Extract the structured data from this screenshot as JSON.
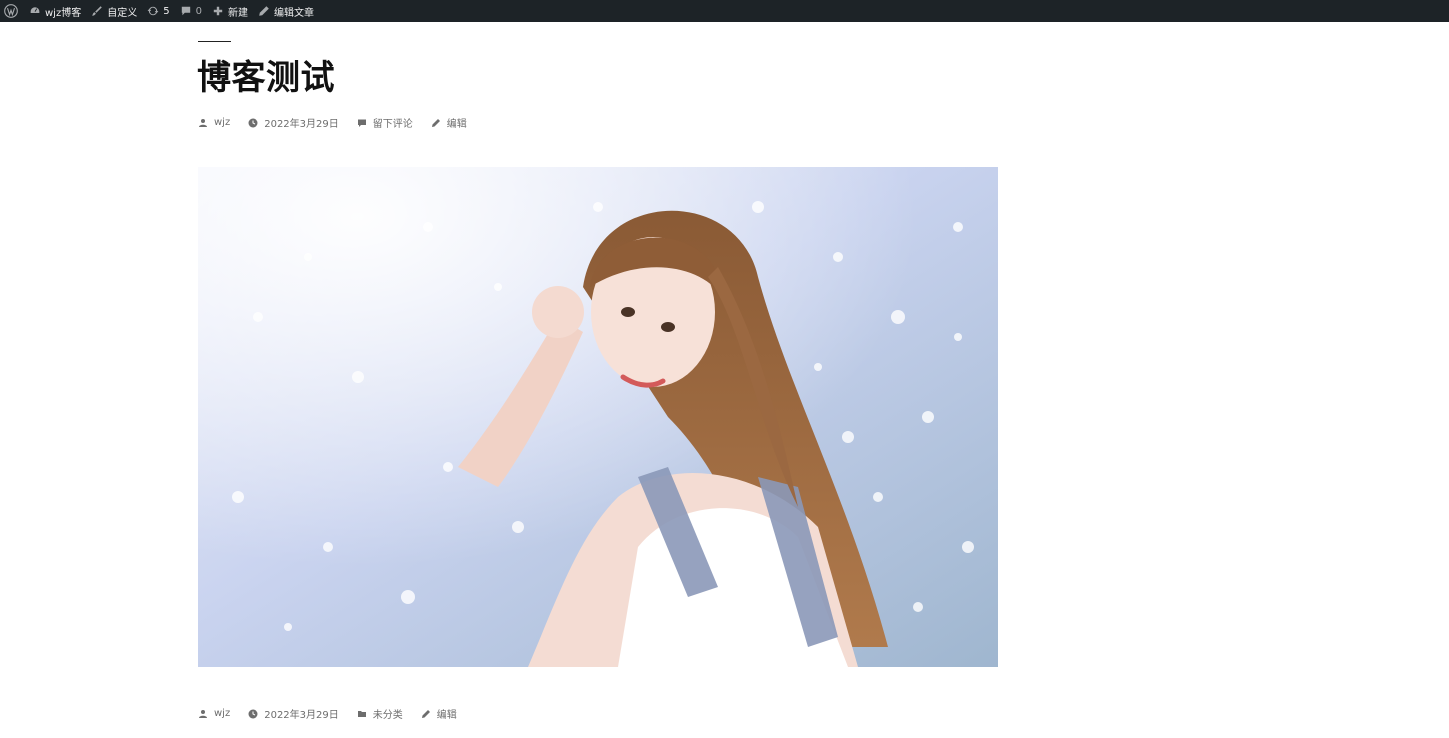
{
  "adminbar": {
    "items": [
      {
        "icon": "wordpress-logo-icon",
        "label": ""
      },
      {
        "icon": "dashboard-icon",
        "label": "wjz博客"
      },
      {
        "icon": "brush-icon",
        "label": "自定义"
      },
      {
        "icon": "updates-icon",
        "label": "5"
      },
      {
        "icon": "comment-icon",
        "label": "0"
      },
      {
        "icon": "plus-icon",
        "label": "新建"
      },
      {
        "icon": "pencil-icon",
        "label": "编辑文章"
      }
    ]
  },
  "post": {
    "title": "博客测试",
    "meta_top": {
      "author": "wjz",
      "date": "2022年3月29日",
      "comments": "留下评论",
      "edit": "编辑"
    },
    "featured_image": {
      "description_icon": "photo-icon"
    },
    "meta_bottom": {
      "author": "wjz",
      "date": "2022年3月29日",
      "category": "未分类",
      "edit": "编辑"
    }
  },
  "colors": {
    "adminbar_bg": "#1d2327",
    "adminbar_text": "#f0f0f1",
    "meta_text": "#6d6d6d",
    "title_text": "#111111"
  }
}
